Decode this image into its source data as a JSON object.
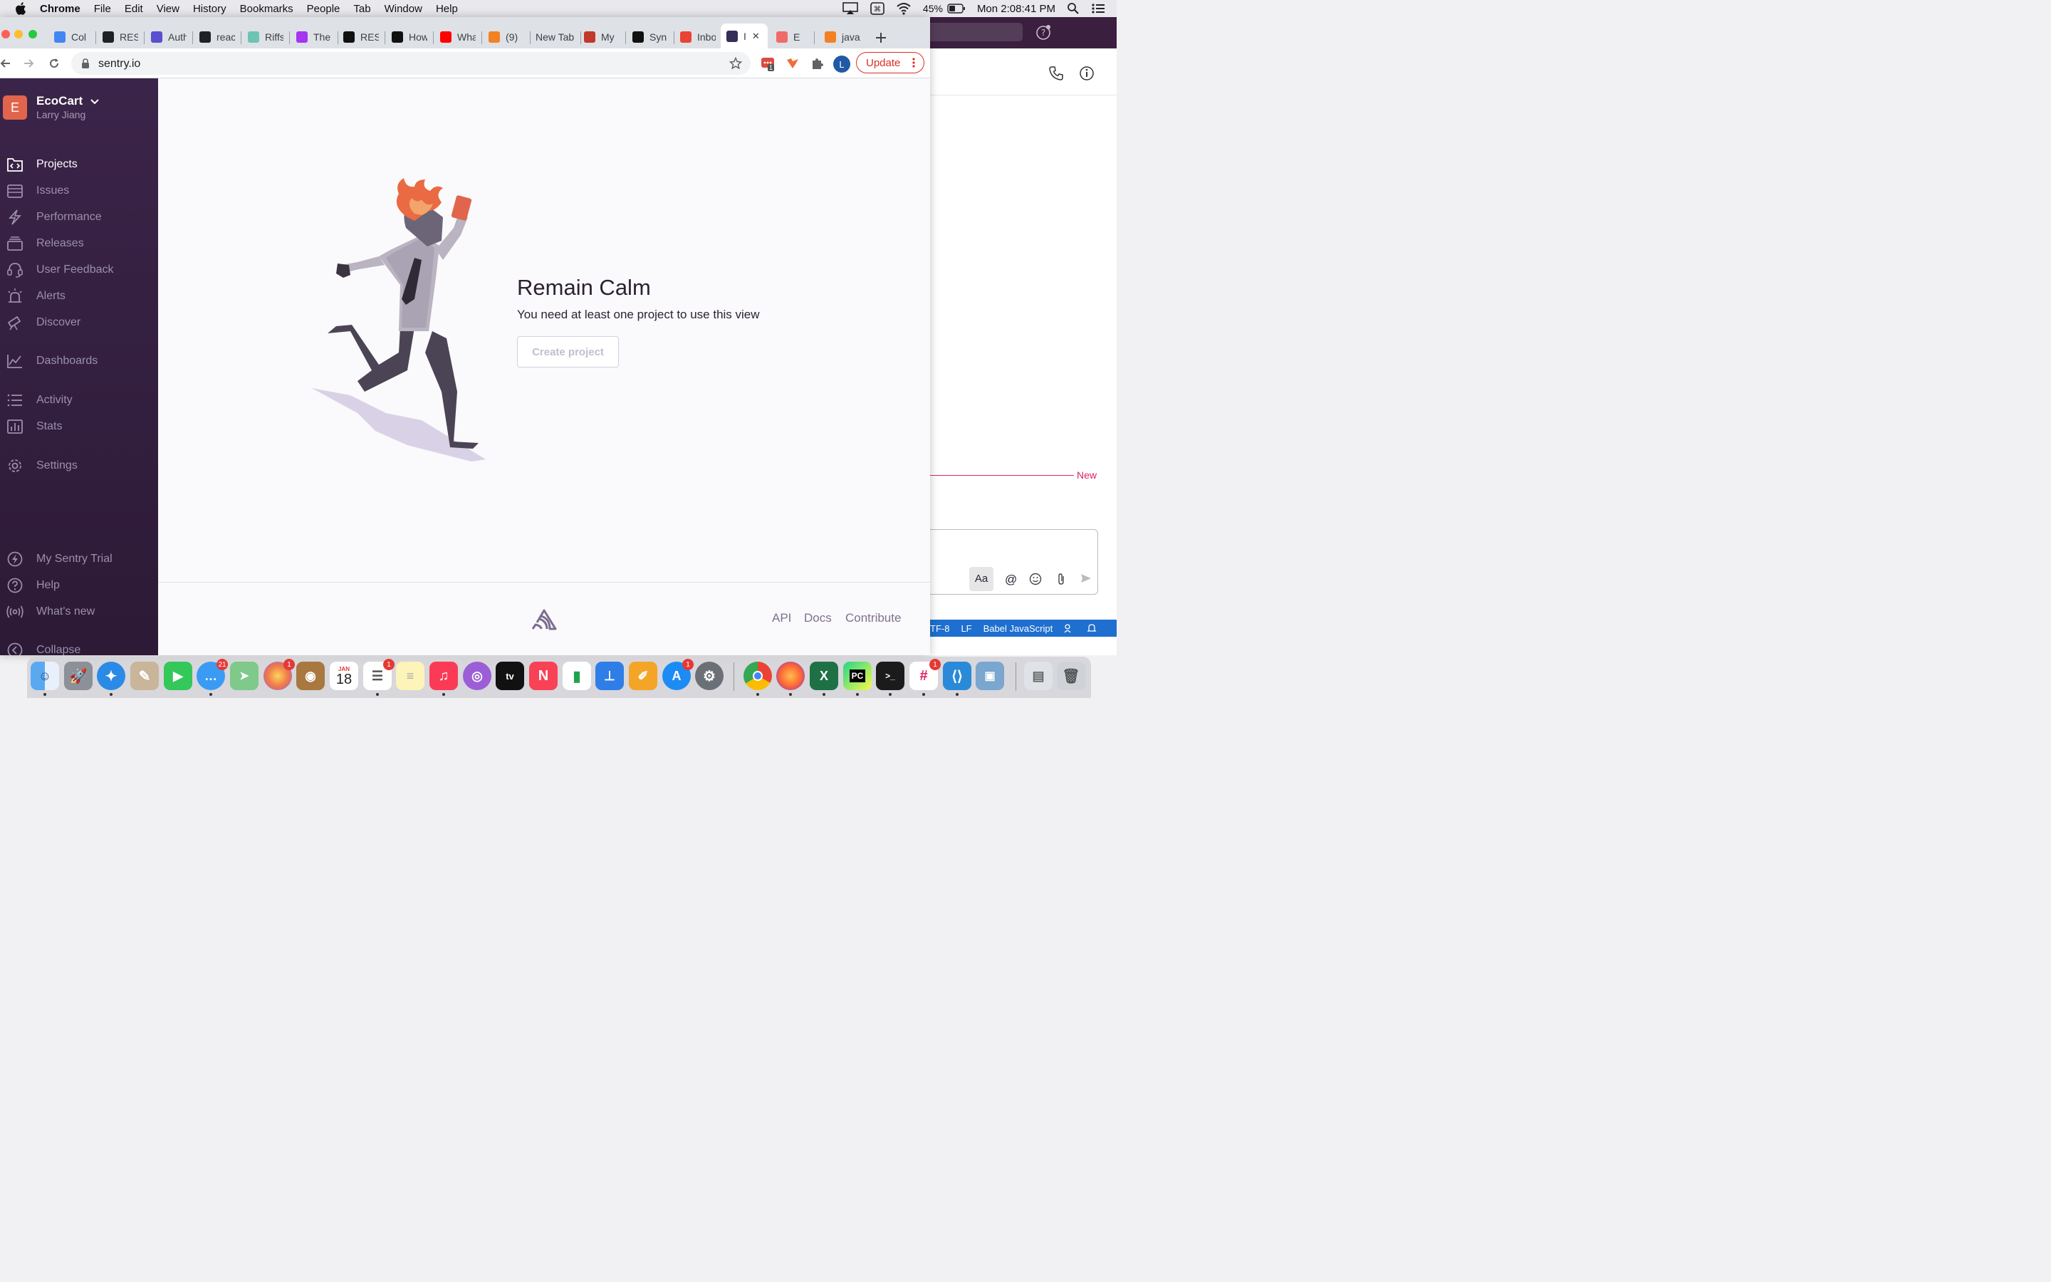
{
  "menubar": {
    "app_name": "Chrome",
    "menus": [
      "File",
      "Edit",
      "View",
      "History",
      "Bookmarks",
      "People",
      "Tab",
      "Window",
      "Help"
    ],
    "battery": "45%",
    "clock": "Mon 2:08:41 PM"
  },
  "tabs": [
    {
      "label": "Col",
      "favicon": "docs-icon",
      "color": "#4285f4"
    },
    {
      "label": "RES",
      "favicon": "compass-icon",
      "color": "#202124"
    },
    {
      "label": "Auth",
      "favicon": "kcd-icon",
      "color": "#5a4fcf"
    },
    {
      "label": "reac",
      "favicon": "codesandbox-icon",
      "color": "#202124"
    },
    {
      "label": "Riffs",
      "favicon": "riffs-icon",
      "color": "#6cc4b3"
    },
    {
      "label": "The",
      "favicon": "udemy-icon",
      "color": "#a435f0"
    },
    {
      "label": "RES",
      "favicon": "g-icon",
      "color": "#111111"
    },
    {
      "label": "How",
      "favicon": "g-icon",
      "color": "#111111"
    },
    {
      "label": "Wha",
      "favicon": "youtube-icon",
      "color": "#ff0000"
    },
    {
      "label": "(9)",
      "favicon": "c-icon",
      "color": "#f48024"
    },
    {
      "label": "New Tab",
      "favicon": "",
      "color": ""
    },
    {
      "label": "My",
      "favicon": "my-icon",
      "color": "#c0392b"
    },
    {
      "label": "Syn",
      "favicon": "symfony-icon",
      "color": "#111111"
    },
    {
      "label": "Inbo",
      "favicon": "gmail-icon",
      "color": "#ea4335"
    },
    {
      "label": "I",
      "favicon": "sentry-icon",
      "color": "#362d59"
    },
    {
      "label": "E",
      "favicon": "asana-icon",
      "color": "#f06a6a"
    },
    {
      "label": "java",
      "favicon": "stackoverflow-icon",
      "color": "#f48024"
    }
  ],
  "address_bar": {
    "url": "sentry.io",
    "update_label": "Update",
    "profile_initial": "L",
    "extension_badge": "1"
  },
  "sidebar": {
    "org_initial": "E",
    "org_name": "EcoCart",
    "user_name": "Larry Jiang",
    "items": [
      {
        "label": "Projects",
        "icon": "projects-icon"
      },
      {
        "label": "Issues",
        "icon": "issues-icon"
      },
      {
        "label": "Performance",
        "icon": "performance-icon"
      },
      {
        "label": "Releases",
        "icon": "releases-icon"
      },
      {
        "label": "User Feedback",
        "icon": "user-feedback-icon"
      },
      {
        "label": "Alerts",
        "icon": "alerts-icon"
      },
      {
        "label": "Discover",
        "icon": "discover-icon"
      },
      {
        "label": "Dashboards",
        "icon": "dashboards-icon"
      },
      {
        "label": "Activity",
        "icon": "activity-icon"
      },
      {
        "label": "Stats",
        "icon": "stats-icon"
      },
      {
        "label": "Settings",
        "icon": "settings-icon"
      }
    ],
    "bottom_items": [
      {
        "label": "My Sentry Trial",
        "icon": "lightning-icon"
      },
      {
        "label": "Help",
        "icon": "help-icon"
      },
      {
        "label": "What's new",
        "icon": "broadcast-icon"
      },
      {
        "label": "Collapse",
        "icon": "collapse-icon"
      }
    ]
  },
  "main": {
    "heading": "Remain Calm",
    "subtext": "You need at least one project to use this view",
    "create_button": "Create project",
    "footer_links": [
      "API",
      "Docs",
      "Contribute"
    ]
  },
  "background_app": {
    "new_label": "New",
    "composer_format": "Aa",
    "status_items": [
      "TF-8",
      "LF",
      "Babel JavaScript"
    ]
  },
  "dock": {
    "calendar_month": "JAN",
    "calendar_day": "18",
    "messages_badge": "21",
    "photos_badge": "1",
    "reminders_badge": "1",
    "appstore_badge": "1",
    "slack_badge": "1"
  },
  "colors": {
    "sidebar_bg": "#3b2449",
    "accent_red": "#d93025",
    "org_avatar": "#e1654c"
  }
}
